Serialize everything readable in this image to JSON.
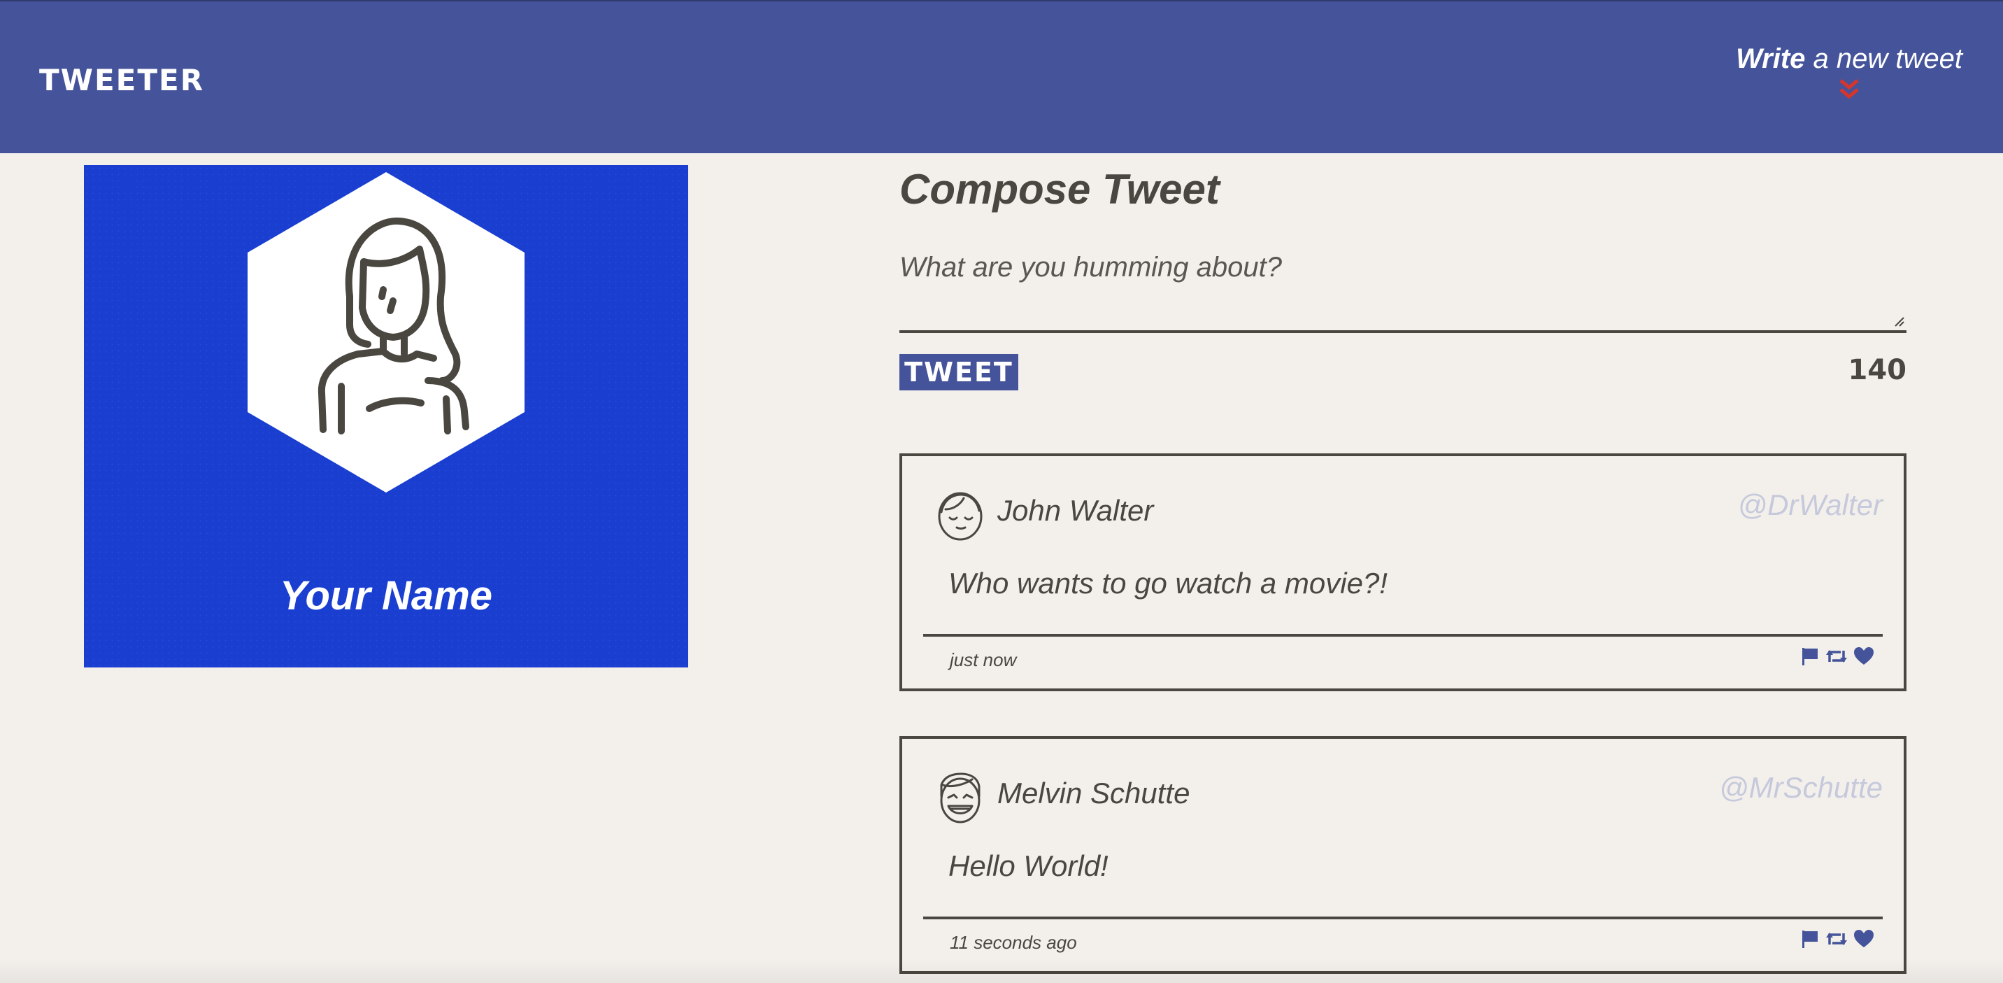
{
  "nav": {
    "brand": "TWEETER",
    "write_bold": "Write",
    "write_rest": " a new tweet",
    "chevron_icon": "double-chevron-down-icon",
    "background": "#45549a",
    "chevron_color": "#d9342b"
  },
  "profile": {
    "name": "Your Name",
    "avatar_icon": "person-avatar-icon",
    "background": "#1a3fd0"
  },
  "compose": {
    "title": "Compose Tweet",
    "placeholder": "What are you humming about?",
    "button_label": "TWEET",
    "counter": "140"
  },
  "tweets": [
    {
      "name": "John Walter",
      "handle": "@DrWalter",
      "text": "Who wants to go watch a movie?!",
      "time": "just now",
      "avatar_icon": "smiling-face-avatar-icon"
    },
    {
      "name": "Melvin Schutte",
      "handle": "@MrSchutte",
      "text": "Hello World!",
      "time": "11 seconds ago",
      "avatar_icon": "laughing-face-avatar-icon"
    }
  ],
  "actions": [
    "flag-icon",
    "retweet-icon",
    "heart-icon"
  ],
  "accent": "#45549a"
}
